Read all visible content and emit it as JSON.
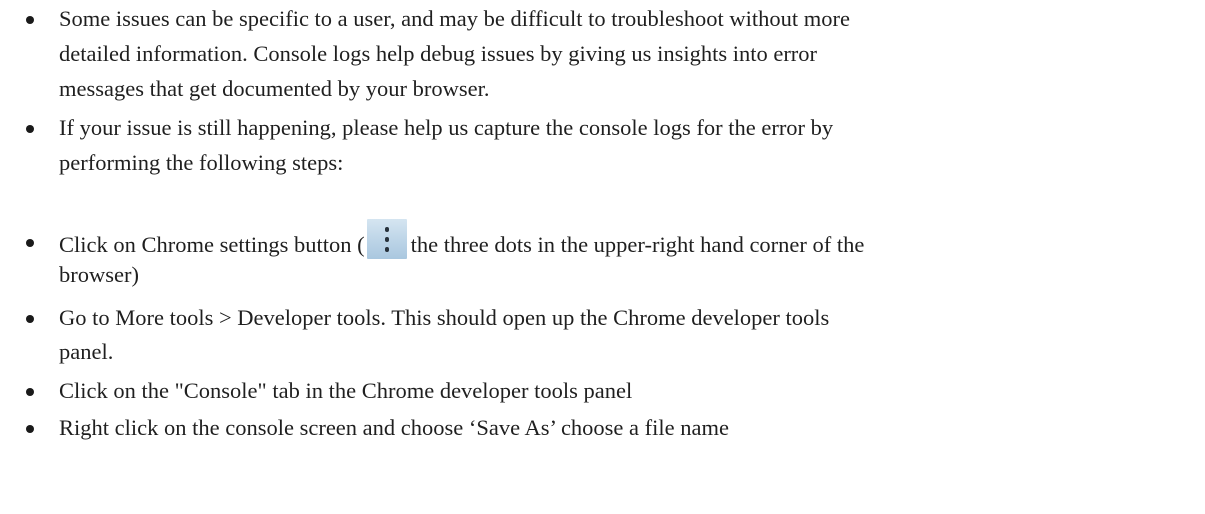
{
  "instructions": {
    "items": [
      {
        "lines": [
          "Some issues can be specific to a user, and may be difficult to troubleshoot without more",
          "detailed information. Console logs help debug issues by giving us insights into error",
          "messages that get documented by your browser."
        ]
      },
      {
        "lines": [
          "If your issue is still happening, please help us capture the console logs for the error by",
          "performing the following steps:"
        ]
      },
      {
        "prefix": "Click on Chrome settings button (",
        "icon": "three-dots-vertical-icon",
        "suffix": "the three dots in the upper-right hand corner of the",
        "lines": [
          "browser)"
        ]
      },
      {
        "lines": [
          "Go to More tools > Developer tools. This should open up the Chrome developer tools",
          "panel."
        ]
      },
      {
        "lines": [
          "Click on the \"Console\" tab in the Chrome developer tools panel"
        ]
      },
      {
        "lines": [
          "Right click on the console screen and choose ‘Save As’ choose a file name"
        ]
      }
    ]
  }
}
